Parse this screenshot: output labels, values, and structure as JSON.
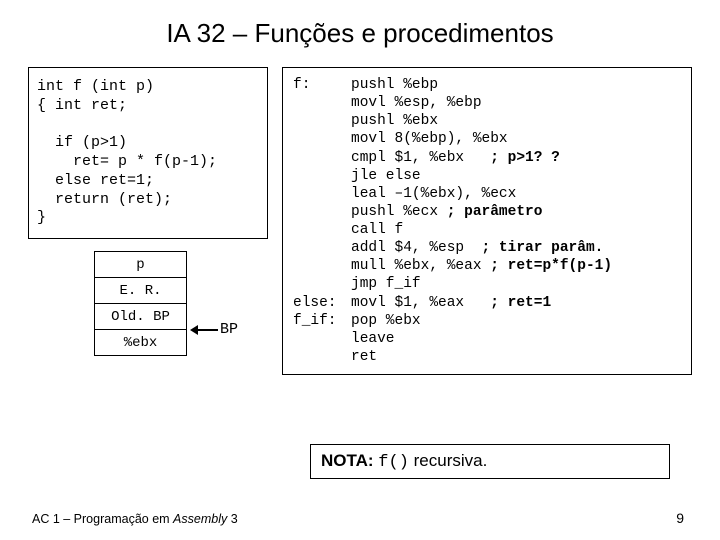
{
  "title": "IA 32 – Funções e procedimentos",
  "c_code": "int f (int p)\n{ int ret;\n\n  if (p>1)\n    ret= p * f(p-1);\n  else ret=1;\n  return (ret);\n}",
  "stack": {
    "rows": [
      "p",
      "E. R.",
      "Old. BP",
      "%ebx"
    ],
    "bp_label": "BP"
  },
  "asm": [
    {
      "label": "f:",
      "code": "pushl %ebp"
    },
    {
      "label": "",
      "code": "movl %esp, %ebp"
    },
    {
      "label": "",
      "code": "pushl %ebx"
    },
    {
      "label": "",
      "code": "movl 8(%ebp), %ebx"
    },
    {
      "label": "",
      "code": "cmpl $1, %ebx   <b>; p>1? ?</b>"
    },
    {
      "label": "",
      "code": "jle else"
    },
    {
      "label": "",
      "code": "leal –1(%ebx), %ecx"
    },
    {
      "label": "",
      "code": "pushl %ecx <b>; parâmetro</b>"
    },
    {
      "label": "",
      "code": "call f"
    },
    {
      "label": "",
      "code": "addl $4, %esp  <b>; tirar parâm.</b>"
    },
    {
      "label": "",
      "code": "mull %ebx, %eax <b>; ret=p*f(p-1)</b>"
    },
    {
      "label": "",
      "code": "jmp f_if"
    },
    {
      "label": "else:",
      "code": "movl $1, %eax   <b>; ret=1</b>"
    },
    {
      "label": "f_if:",
      "code": "pop %ebx"
    },
    {
      "label": "",
      "code": "leave"
    },
    {
      "label": "",
      "code": "ret"
    }
  ],
  "nota_prefix": "NOTA:",
  "nota_code": "f()",
  "nota_suffix": " recursiva.",
  "footer_left_plain": "AC 1 – Programação em ",
  "footer_left_italic": "Assembly",
  "footer_left_tail": " 3",
  "page_num": "9"
}
